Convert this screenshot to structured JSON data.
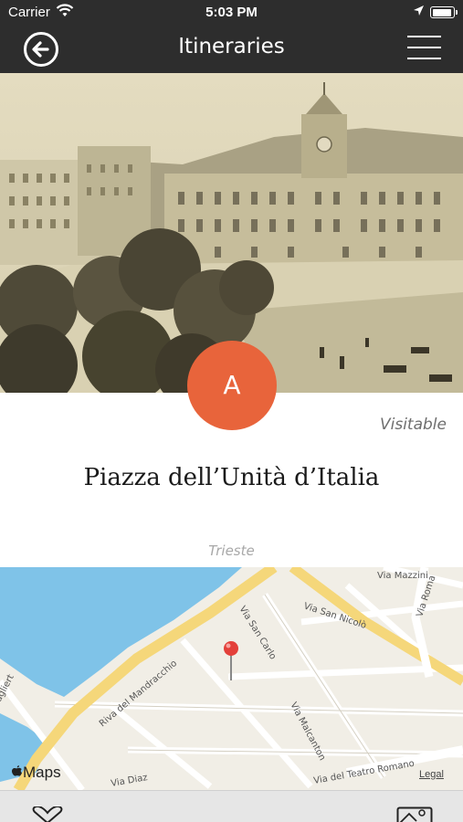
{
  "status_bar": {
    "carrier": "Carrier",
    "time": "5:03 PM",
    "wifi_icon": "wifi-icon",
    "location_icon": "location-arrow-icon",
    "battery_icon": "battery-icon"
  },
  "nav": {
    "title": "Itineraries",
    "back_icon": "back-arrow-circle-icon",
    "menu_icon": "hamburger-menu-icon"
  },
  "place": {
    "badge": "A",
    "status": "Visitable",
    "title": "Piazza dell’Unità d’Italia",
    "city": "Trieste"
  },
  "map": {
    "provider": "Maps",
    "legal": "Legal",
    "streets": [
      "Via Mazzini",
      "Via San Nicolò",
      "Via Roma",
      "Via San Carlo",
      "Riva del Mandracchio",
      "Via Malcanton",
      "Via del Teatro Romano",
      "Via Diaz",
      "agliert"
    ],
    "pin_icon": "map-pin-icon"
  },
  "bottom_bar": {
    "favorite_icon": "heart-icon",
    "gallery_icon": "image-gallery-icon"
  },
  "colors": {
    "bar_background": "#2d2d2d",
    "accent": "#e8643b",
    "map_water": "#7fc3e8",
    "map_land": "#f1eee6"
  }
}
